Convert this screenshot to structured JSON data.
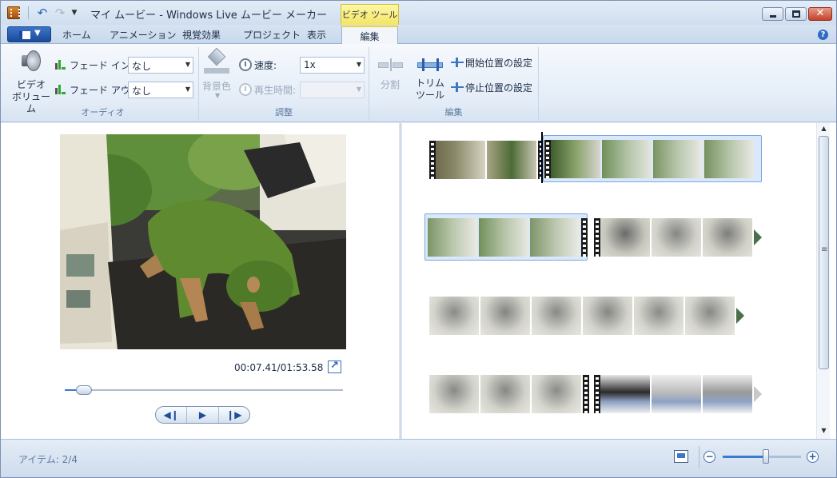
{
  "window": {
    "title": "マイ ムービー - Windows Live ムービー メーカー",
    "context_tab": "ビデオ ツール"
  },
  "tabs": [
    {
      "label": "ホーム",
      "active": false
    },
    {
      "label": "アニメーション",
      "active": false
    },
    {
      "label": "視覚効果",
      "active": false
    },
    {
      "label": "プロジェクト",
      "active": false
    },
    {
      "label": "表示",
      "active": false
    },
    {
      "label": "編集",
      "active": true
    }
  ],
  "ribbon": {
    "audio": {
      "group_label": "オーディオ",
      "video_volume_label": "ビデオ\nボリューム",
      "fade_in_label": "フェード イン:",
      "fade_in_value": "なし",
      "fade_out_label": "フェード アウト:",
      "fade_out_value": "なし"
    },
    "adjust": {
      "group_label": "調整",
      "background_color_label": "背景色",
      "speed_label": "速度:",
      "speed_value": "1x",
      "duration_label": "再生時間:",
      "duration_value": ""
    },
    "edit": {
      "group_label": "編集",
      "split_label": "分割",
      "trim_tool_label": "トリム\nツール",
      "set_start_label": "開始位置の設定",
      "set_end_label": "停止位置の設定"
    }
  },
  "preview": {
    "time_readout": "00:07.41/01:53.58",
    "seek_progress": 0.07
  },
  "status": {
    "items_text": "アイテム: 2/4",
    "zoom_level": 0.55
  },
  "colors": {
    "accent": "#3c7ad1",
    "context_tab": "#f3e566",
    "selection": "#d9e8fa"
  }
}
